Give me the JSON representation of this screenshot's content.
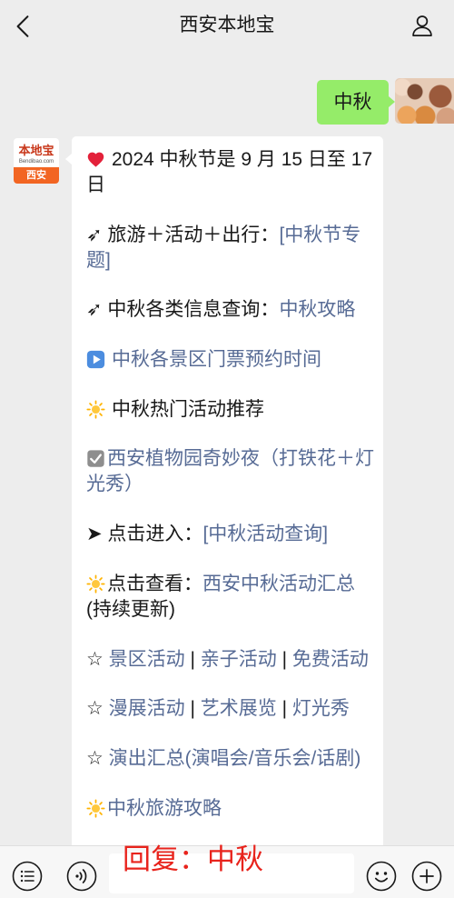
{
  "header": {
    "title": "西安本地宝",
    "back_icon": "chevron-left-icon",
    "profile_icon": "person-icon"
  },
  "conversation": {
    "user_message": {
      "text": "中秋",
      "avatar_icon": "user-photo-avatar"
    },
    "account_avatar": {
      "brand": "本地宝",
      "site": "Bendibao.com",
      "city": "西安"
    },
    "reply_paragraphs": [
      {
        "icon": "heart-icon",
        "segments": [
          {
            "text": "2024 中秋节是 9 月 15 日至 17 日"
          }
        ]
      },
      {
        "segments": [
          {
            "text": "➶ 旅游＋活动＋出行："
          },
          {
            "link": "[中秋节专题]"
          }
        ]
      },
      {
        "segments": [
          {
            "text": "➶ 中秋各类信息查询："
          },
          {
            "link": "中秋攻略"
          }
        ]
      },
      {
        "icon": "play-button-icon",
        "segments": [
          {
            "link": "中秋各景区门票预约时间"
          }
        ]
      },
      {
        "icon": "sun-icon",
        "segments": [
          {
            "text": "中秋热门活动推荐"
          }
        ]
      },
      {
        "icon": "checkbox-icon",
        "segments": [
          {
            "link": "西安植物园奇妙夜（打铁花＋灯光秀）"
          }
        ]
      },
      {
        "segments": [
          {
            "text": "➤ 点击进入："
          },
          {
            "link": "[中秋活动查询]"
          }
        ]
      },
      {
        "icon": "sun-icon",
        "segments": [
          {
            "text": "点击查看："
          },
          {
            "link": "西安中秋活动汇总"
          },
          {
            "text": "(持续更新)"
          }
        ]
      },
      {
        "segments": [
          {
            "text": "☆ "
          },
          {
            "link": "景区活动"
          },
          {
            "text": " | "
          },
          {
            "link": "亲子活动"
          },
          {
            "text": " | "
          },
          {
            "link": "免费活动"
          }
        ]
      },
      {
        "segments": [
          {
            "text": "☆ "
          },
          {
            "link": "漫展活动"
          },
          {
            "text": " | "
          },
          {
            "link": "艺术展览"
          },
          {
            "text": " | "
          },
          {
            "link": "灯光秀"
          }
        ]
      },
      {
        "segments": [
          {
            "text": "☆ "
          },
          {
            "link": "演出汇总(演唱会/音乐会/话剧)"
          }
        ]
      },
      {
        "icon": "sun-icon",
        "segments": [
          {
            "link": "中秋旅游攻略"
          }
        ]
      }
    ]
  },
  "input_bar": {
    "overlay_text": "回复：中秋",
    "menu_icon": "list-menu-icon",
    "voice_icon": "voice-icon",
    "emoji_icon": "emoji-icon",
    "plus_icon": "plus-icon"
  },
  "colors": {
    "background": "#ededed",
    "text": "#191919",
    "link": "#576b95",
    "user_bubble": "#95ec69",
    "overlay_text": "#e8231c",
    "brand_orange": "#f26522"
  }
}
